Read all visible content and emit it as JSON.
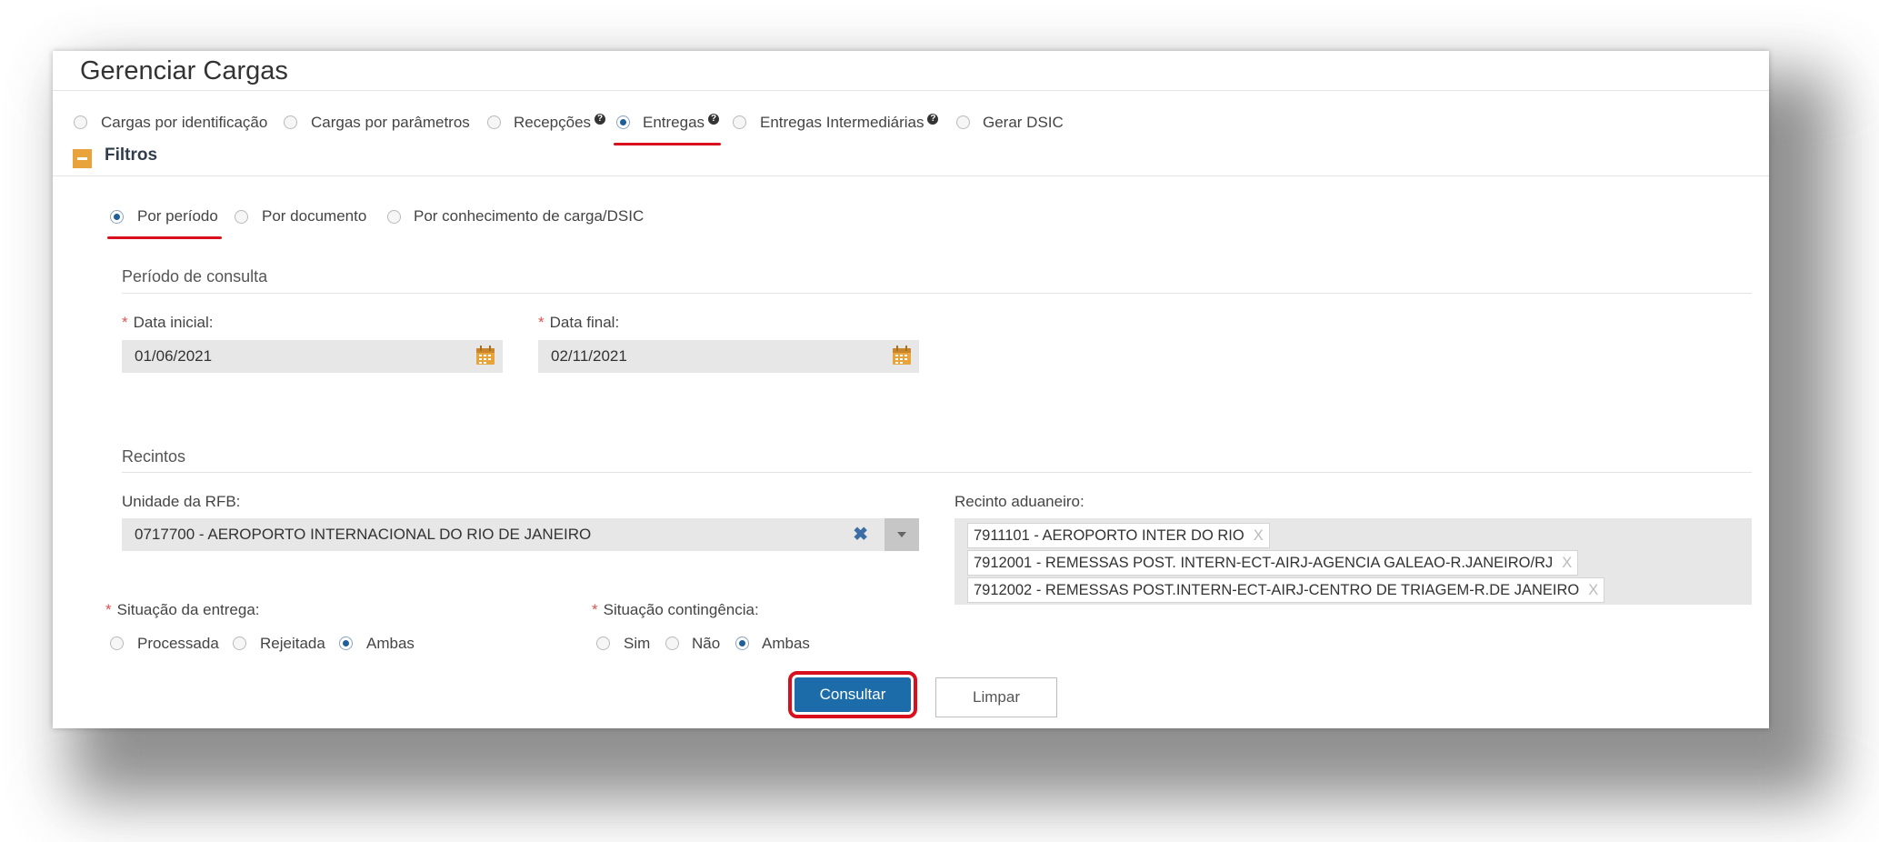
{
  "page": {
    "title": "Gerenciar Cargas"
  },
  "tabs": [
    {
      "label": "Cargas por identificação",
      "selected": false,
      "help": false
    },
    {
      "label": "Cargas por parâmetros",
      "selected": false,
      "help": false
    },
    {
      "label": "Recepções",
      "selected": false,
      "help": true
    },
    {
      "label": "Entregas",
      "selected": true,
      "help": true
    },
    {
      "label": "Entregas Intermediárias",
      "selected": false,
      "help": true
    },
    {
      "label": "Gerar DSIC",
      "selected": false,
      "help": false
    }
  ],
  "help_glyph": "?",
  "filters": {
    "title": "Filtros",
    "modes": [
      {
        "label": "Por período",
        "selected": true
      },
      {
        "label": "Por documento",
        "selected": false
      },
      {
        "label": "Por conhecimento de carga/DSIC",
        "selected": false
      }
    ],
    "period": {
      "section_title": "Período de consulta",
      "required_mark": "*",
      "start_label": "Data inicial:",
      "start_value": "01/06/2021",
      "end_label": "Data final:",
      "end_value": "02/11/2021"
    },
    "recintos": {
      "section_title": "Recintos",
      "unit_label": "Unidade da RFB:",
      "unit_value": "0717700 - AEROPORTO INTERNACIONAL DO RIO DE JANEIRO",
      "clear_glyph": "✖",
      "customs_label": "Recinto aduaneiro:",
      "tag_remove_glyph": "X",
      "customs_tags": [
        "7911101 - AEROPORTO INTER DO RIO",
        "7912001 - REMESSAS POST. INTERN-ECT-AIRJ-AGENCIA GALEAO-R.JANEIRO/RJ",
        "7912002 - REMESSAS POST.INTERN-ECT-AIRJ-CENTRO DE TRIAGEM-R.DE JANEIRO"
      ]
    },
    "delivery_status": {
      "label": "Situação da entrega:",
      "options": [
        {
          "label": "Processada",
          "selected": false
        },
        {
          "label": "Rejeitada",
          "selected": false
        },
        {
          "label": "Ambas",
          "selected": true
        }
      ]
    },
    "contingency_status": {
      "label": "Situação contingência:",
      "options": [
        {
          "label": "Sim",
          "selected": false
        },
        {
          "label": "Não",
          "selected": false
        },
        {
          "label": "Ambas",
          "selected": true
        }
      ]
    }
  },
  "actions": {
    "search_label": "Consultar",
    "clear_label": "Limpar"
  },
  "colors": {
    "accent": "#1b6ca8",
    "highlight": "#d8101e",
    "collapse": "#e8a33b"
  }
}
